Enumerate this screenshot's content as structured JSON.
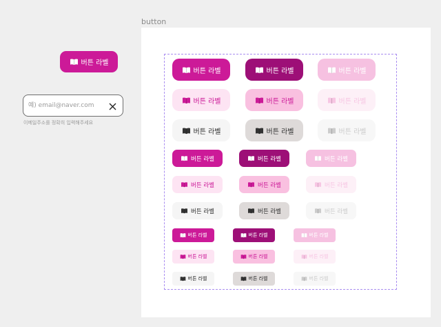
{
  "frame": {
    "label": "button"
  },
  "standalone_button": {
    "label": "버튼 라벨",
    "icon": "book-icon",
    "style": "solid-default"
  },
  "email_field": {
    "placeholder": "예) email@naver.com",
    "value": "",
    "clear_icon": "close-icon",
    "helper_text": "이메일주소를 정확히 입력해주세요"
  },
  "colors": {
    "primary": "#cc1a98",
    "primary_pressed": "#9d0f77",
    "primary_disabled": "#f6c1e1",
    "tint": "#fde4f3",
    "tint_pressed": "#f9c0e0",
    "gray": "#f5f5f5",
    "gray_pressed": "#dedad9",
    "selection_outline": "#a98cf0"
  },
  "button_grid": {
    "sizes": [
      {
        "size": "large",
        "rows": [
          {
            "variant": "solid",
            "buttons": [
              {
                "state": "default",
                "label": "버튼 라벨",
                "icon": "book-icon"
              },
              {
                "state": "pressed",
                "label": "버튼 라벨",
                "icon": "book-icon"
              },
              {
                "state": "disabled",
                "label": "버튼 라벨",
                "icon": "book-icon"
              }
            ]
          },
          {
            "variant": "tint",
            "buttons": [
              {
                "state": "default",
                "label": "버튼 라벨",
                "icon": "book-icon"
              },
              {
                "state": "pressed",
                "label": "버튼 라벨",
                "icon": "book-icon"
              },
              {
                "state": "disabled",
                "label": "버튼 라벨",
                "icon": "book-icon"
              }
            ]
          },
          {
            "variant": "gray",
            "buttons": [
              {
                "state": "default",
                "label": "버튼 라벨",
                "icon": "book-icon"
              },
              {
                "state": "pressed",
                "label": "버튼 라벨",
                "icon": "book-icon"
              },
              {
                "state": "disabled",
                "label": "버튼 라벨",
                "icon": "book-icon"
              }
            ]
          }
        ]
      },
      {
        "size": "medium",
        "rows": [
          {
            "variant": "solid",
            "buttons": [
              {
                "state": "default",
                "label": "버튼 라벨",
                "icon": "book-icon"
              },
              {
                "state": "pressed",
                "label": "버튼 라벨",
                "icon": "book-icon"
              },
              {
                "state": "disabled",
                "label": "버튼 라벨",
                "icon": "book-icon"
              }
            ]
          },
          {
            "variant": "tint",
            "buttons": [
              {
                "state": "default",
                "label": "버튼 라벨",
                "icon": "book-icon"
              },
              {
                "state": "pressed",
                "label": "버튼 라벨",
                "icon": "book-icon"
              },
              {
                "state": "disabled",
                "label": "버튼 라벨",
                "icon": "book-icon"
              }
            ]
          },
          {
            "variant": "gray",
            "buttons": [
              {
                "state": "default",
                "label": "버튼 라벨",
                "icon": "book-icon"
              },
              {
                "state": "pressed",
                "label": "버튼 라벨",
                "icon": "book-icon"
              },
              {
                "state": "disabled",
                "label": "버튼 라벨",
                "icon": "book-icon"
              }
            ]
          }
        ]
      },
      {
        "size": "small",
        "rows": [
          {
            "variant": "solid",
            "buttons": [
              {
                "state": "default",
                "label": "버튼 라벨",
                "icon": "book-icon"
              },
              {
                "state": "pressed",
                "label": "버튼 라벨",
                "icon": "book-icon"
              },
              {
                "state": "disabled",
                "label": "버튼 라벨",
                "icon": "book-icon"
              }
            ]
          },
          {
            "variant": "tint",
            "buttons": [
              {
                "state": "default",
                "label": "버튼 라벨",
                "icon": "book-icon"
              },
              {
                "state": "pressed",
                "label": "버튼 라벨",
                "icon": "book-icon"
              },
              {
                "state": "disabled",
                "label": "버튼 라벨",
                "icon": "book-icon"
              }
            ]
          },
          {
            "variant": "gray",
            "buttons": [
              {
                "state": "default",
                "label": "버튼 라벨",
                "icon": "book-icon"
              },
              {
                "state": "pressed",
                "label": "버튼 라벨",
                "icon": "book-icon"
              },
              {
                "state": "disabled",
                "label": "버튼 라벨",
                "icon": "book-icon"
              }
            ]
          }
        ]
      }
    ]
  }
}
